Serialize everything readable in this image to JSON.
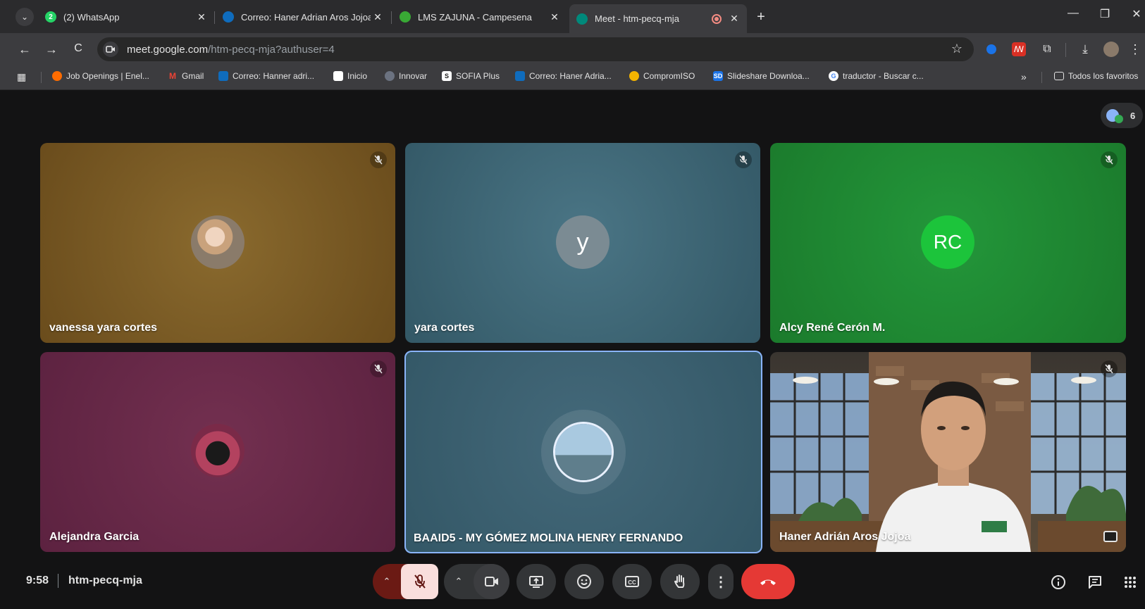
{
  "browser": {
    "tabs": [
      {
        "label": "(2) WhatsApp",
        "badge": "2"
      },
      {
        "label": "Correo: Haner Adrian Aros Jojoa"
      },
      {
        "label": "LMS ZAJUNA - Campesena"
      },
      {
        "label": "Meet - htm-pecq-mja"
      }
    ],
    "url_host": "meet.google.com",
    "url_path": "/htm-pecq-mja?authuser=4",
    "bookmarks": [
      "Job Openings | Enel...",
      "Gmail",
      "Correo: Hanner adri...",
      "Inicio",
      "Innovar",
      "SOFIA Plus",
      "Correo: Haner Adria...",
      "CompromISO",
      "Slideshare Downloa...",
      "traductor - Buscar c..."
    ],
    "bookmarks_overflow": "»",
    "all_bookmarks": "Todos los favoritos"
  },
  "meet": {
    "participant_count": "6",
    "tiles": [
      {
        "name": "vanessa yara cortes",
        "bg": "#7a5a24",
        "avatar_type": "photo"
      },
      {
        "name": "yara cortes",
        "bg": "#3e6878",
        "avatar_type": "initial",
        "initial": "y",
        "avatar_color": "#7b8b93"
      },
      {
        "name": "Alcy René Cerón M.",
        "bg": "#1f8a32",
        "avatar_type": "initial",
        "initial": "RC",
        "avatar_color": "#1cc43b"
      },
      {
        "name": "Alejandra Garcia",
        "bg": "#6a2945",
        "avatar_type": "photo"
      },
      {
        "name": "BAAID5 - MY GÓMEZ MOLINA HENRY FERNANDO",
        "bg": "#3b6272",
        "avatar_type": "photo"
      },
      {
        "name": "Haner Adrián Aros Jojoa",
        "bg": "#3b3a35",
        "avatar_type": "video"
      }
    ],
    "time": "9:58",
    "meeting_code": "htm-pecq-mja"
  },
  "colors": {
    "end_call": "#e53935",
    "mic_off_bg": "#f9dedc",
    "mic_arrow_bg": "#6b1a14"
  }
}
